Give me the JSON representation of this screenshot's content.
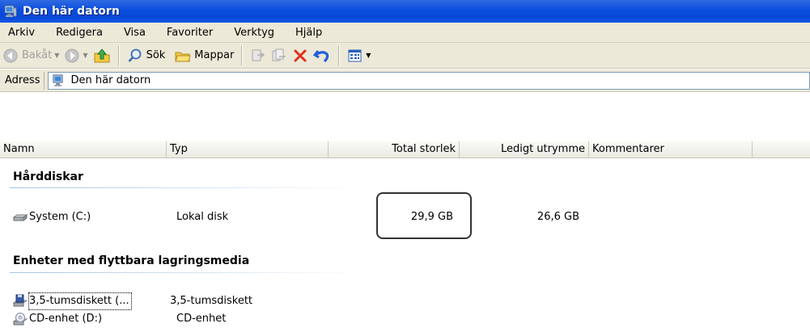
{
  "window": {
    "title": "Den här datorn"
  },
  "menu": [
    "Arkiv",
    "Redigera",
    "Visa",
    "Favoriter",
    "Verktyg",
    "Hjälp"
  ],
  "toolbar": {
    "back_label": "Bakåt",
    "search_label": "Sök",
    "folders_label": "Mappar"
  },
  "address": {
    "label": "Adress",
    "value": "Den här datorn"
  },
  "columns": [
    "Namn",
    "Typ",
    "Total storlek",
    "Ledigt utrymme",
    "Kommentarer"
  ],
  "groups": [
    {
      "title": "Hårddiskar",
      "items": [
        {
          "name": "System (C:)",
          "type": "Lokal disk",
          "total": "29,9 GB",
          "free": "26,6 GB",
          "icon": "hard-drive-icon"
        }
      ]
    },
    {
      "title": "Enheter med flyttbara lagringsmedia",
      "items": [
        {
          "name": "3,5-tumsdiskett (...",
          "type": "3,5-tumsdiskett",
          "total": "",
          "free": "",
          "icon": "floppy-drive-icon"
        },
        {
          "name": "CD-enhet (D:)",
          "type": "CD-enhet",
          "total": "",
          "free": "",
          "icon": "cd-drive-icon"
        }
      ]
    }
  ],
  "colors": {
    "titlebar": "#0a4ee0",
    "chrome": "#ece9d8",
    "group_line": "#a8c4e0"
  }
}
